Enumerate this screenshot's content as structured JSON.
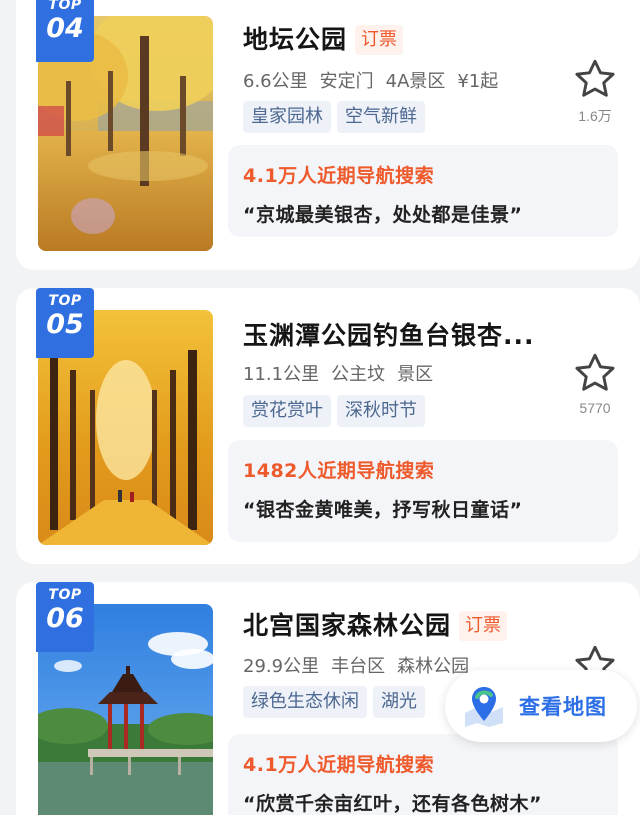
{
  "items": [
    {
      "rank_badge": "TOP",
      "rank": "04",
      "name": "地坛公园",
      "ticket": "订票",
      "distance": "6.6公里",
      "district": "安定门",
      "level": "4A景区",
      "price": "¥1起",
      "tags": [
        "皇家园林",
        "空气新鲜"
      ],
      "fav_count": "1.6万",
      "heat": "4.1万人近期导航搜索",
      "quote": "“京城最美银杏，处处都是佳景”",
      "image": "ginkgo-park-path"
    },
    {
      "rank_badge": "TOP",
      "rank": "05",
      "name": "玉渊潭公园钓鱼台银杏...",
      "distance": "11.1公里",
      "district": "公主坟",
      "level": "景区",
      "tags": [
        "赏花赏叶",
        "深秋时节"
      ],
      "fav_count": "5770",
      "heat": "1482人近期导航搜索",
      "quote": "“银杏金黄唯美，抒写秋日童话”",
      "image": "golden-ginkgo-avenue"
    },
    {
      "rank_badge": "TOP",
      "rank": "06",
      "name": "北宫国家森林公园",
      "ticket": "订票",
      "distance": "29.9公里",
      "district": "丰台区",
      "level": "森林公园",
      "tags": [
        "绿色生态休闲",
        "湖光"
      ],
      "heat": "4.1万人近期导航搜索",
      "quote": "“欣赏千余亩红叶，还有各色树木”",
      "image": "lake-pavilion"
    }
  ],
  "map_button": {
    "label": "查看地图",
    "icon": "map-pin-icon"
  },
  "colors": {
    "accent": "#2c6ee6",
    "badge": "#2f6fe0",
    "hot": "#ee5a2c",
    "tag_text": "#4c6790"
  }
}
